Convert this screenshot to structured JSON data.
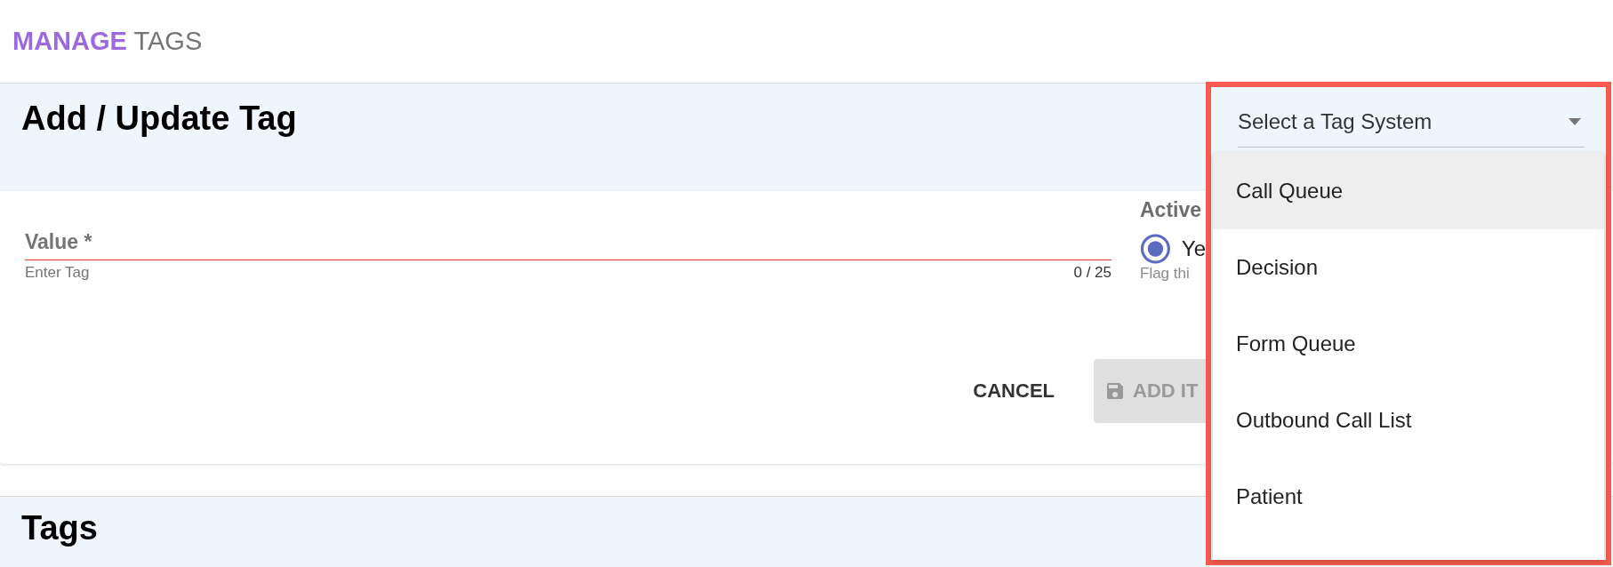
{
  "header": {
    "title_bold": "MANAGE",
    "title_rest": "TAGS"
  },
  "form": {
    "title": "Add / Update Tag",
    "value_field": {
      "label": "Value *",
      "hint": "Enter Tag",
      "counter": "0 / 25",
      "error": true
    },
    "active": {
      "label": "Active",
      "options": [
        {
          "label": "Ye",
          "selected": true
        }
      ],
      "hint": "Flag thi"
    },
    "buttons": [
      {
        "label": "CANCEL",
        "kind": "text",
        "disabled": false
      },
      {
        "label": "ADD IT",
        "kind": "save",
        "disabled": true
      }
    ]
  },
  "tags_section": {
    "title": "Tags"
  },
  "tag_system_select": {
    "placeholder": "Select a Tag System",
    "expanded": true,
    "highlighted": true,
    "options": [
      {
        "label": "Call Queue",
        "selected": true
      },
      {
        "label": "Decision",
        "selected": false
      },
      {
        "label": "Form Queue",
        "selected": false
      },
      {
        "label": "Outbound Call List",
        "selected": false
      },
      {
        "label": "Patient",
        "selected": false
      }
    ]
  }
}
